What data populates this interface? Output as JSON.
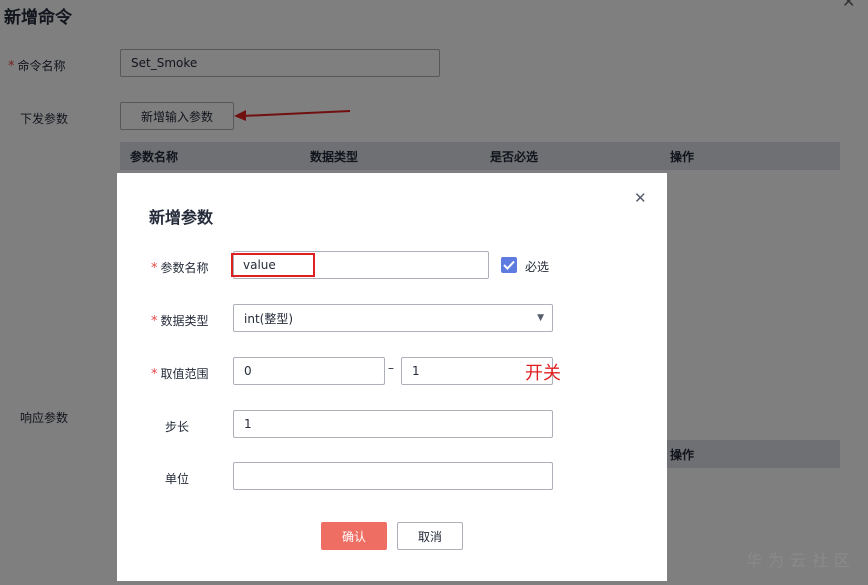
{
  "page": {
    "title": "新增命令",
    "command_name_label": "命令名称",
    "command_name_value": "Set_Smoke",
    "send_params_label": "下发参数",
    "add_input_param_button": "新增输入参数",
    "response_params_label": "响应参数",
    "table_headers": [
      "参数名称",
      "数据类型",
      "是否必选",
      "操作"
    ],
    "response_table_op_header": "操作"
  },
  "modal": {
    "title": "新增参数",
    "param_name_label": "参数名称",
    "param_name_value": "value",
    "required_label": "必选",
    "required_checked": true,
    "data_type_label": "数据类型",
    "data_type_value": "int(整型)",
    "range_label": "取值范围",
    "range_min": "0",
    "range_max": "1",
    "range_separator": "–",
    "step_label": "步长",
    "step_value": "1",
    "unit_label": "单位",
    "unit_value": "",
    "confirm_button": "确认",
    "cancel_button": "取消",
    "annotation_text": "开关"
  },
  "watermark": "华为云社区",
  "colors": {
    "required_star": "#e54545",
    "primary_button": "#ee6e63",
    "checkbox": "#5e7ce0",
    "annotation_red": "#e02020",
    "table_header_bg": "#dfe1e6"
  },
  "icons": [
    "close-icon",
    "chevron-down-icon",
    "checkmark-icon",
    "red-arrow-icon"
  ]
}
